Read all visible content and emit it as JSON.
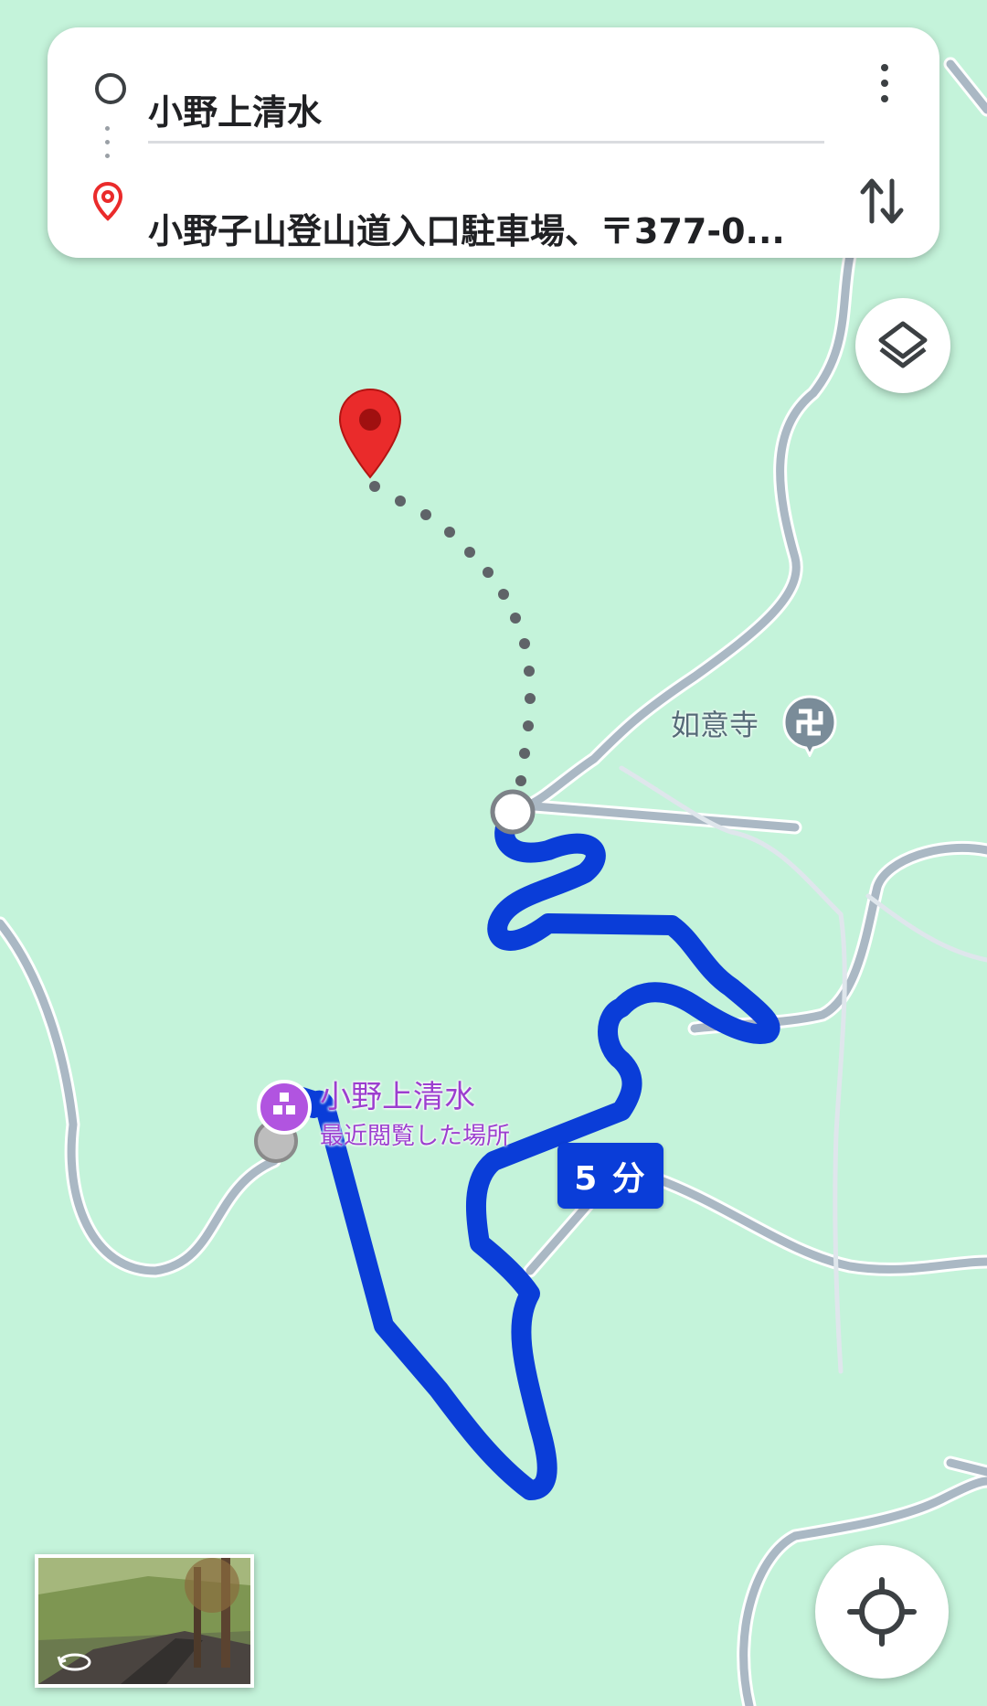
{
  "directions": {
    "origin": "小野上清水",
    "destination": "小野子山登山道入口駐車場、〒377-0..."
  },
  "map": {
    "route_duration_label": "5 分",
    "start_place": {
      "name": "小野上清水",
      "subtitle": "最近閲覧した場所"
    },
    "temple": {
      "name": "如意寺",
      "symbol": "卍"
    }
  },
  "icons": {
    "origin": "origin-circle-icon",
    "destination": "destination-pin-icon",
    "more": "more-vert-icon",
    "swap": "swap-vert-icon",
    "layers": "layers-icon",
    "locate": "my-location-icon",
    "street_view": "street-view-rotate-icon"
  },
  "colors": {
    "map_background": "#c4f3da",
    "road": "#aab8c4",
    "route": "#0a3dd8",
    "destination_pin": "#ea2b2b",
    "poi": "#b154e0",
    "temple_badge": "#7a8c99"
  }
}
